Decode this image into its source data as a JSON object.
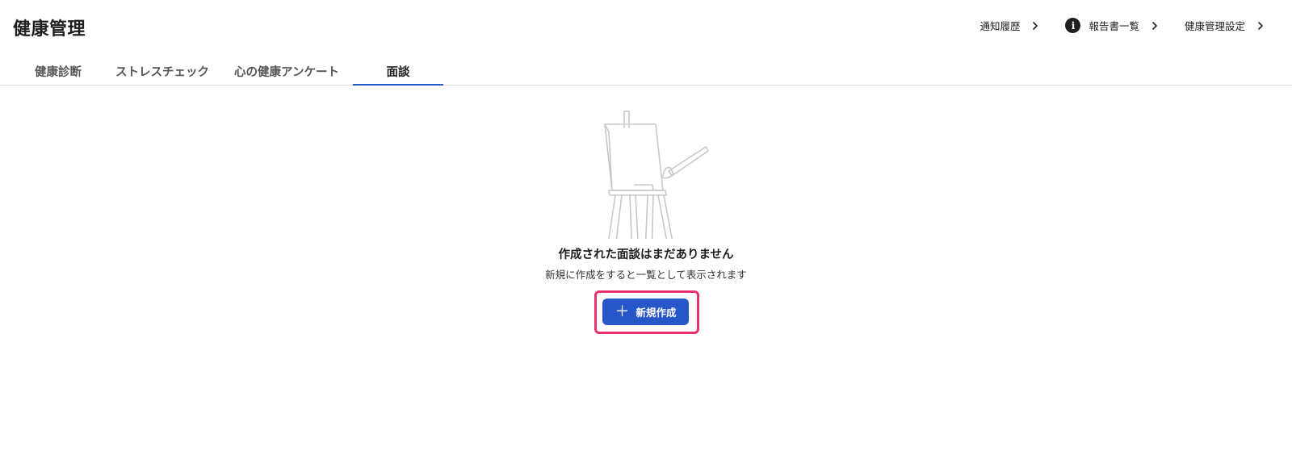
{
  "header": {
    "title": "健康管理",
    "links": [
      {
        "label": "通知履歴",
        "icon": "chevron-right-icon"
      },
      {
        "label": "報告書一覧",
        "icon": "chevron-right-icon",
        "leading_icon": "info-icon"
      },
      {
        "label": "健康管理設定",
        "icon": "chevron-right-icon"
      }
    ]
  },
  "tabs": [
    {
      "label": "健康診断"
    },
    {
      "label": "ストレスチェック"
    },
    {
      "label": "心の健康アンケート"
    },
    {
      "label": "面談",
      "active": true
    }
  ],
  "empty_state": {
    "illustration": "easel-icon",
    "title": "作成された面談はまだありません",
    "subtitle": "新規に作成をすると一覧として表示されます",
    "button_label": "新規作成",
    "button_icon": "plus-icon"
  },
  "colors": {
    "accent": "#2756c9",
    "highlight": "#e9306a",
    "text": "#1f1f1f"
  }
}
